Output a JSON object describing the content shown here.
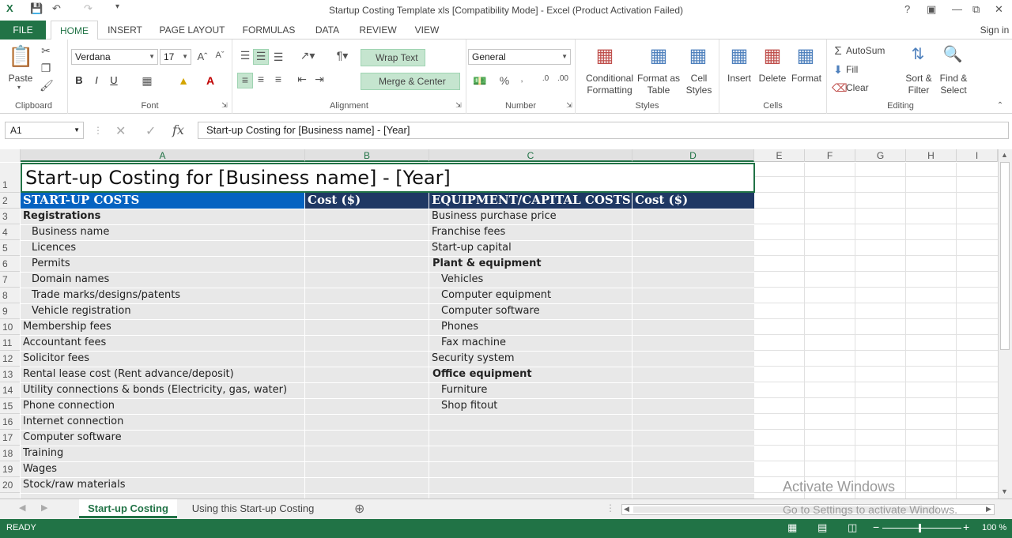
{
  "window": {
    "title": "Startup Costing Template xls  [Compatibility Mode] - Excel (Product Activation Failed)",
    "help": "?",
    "sign_in": "Sign in"
  },
  "tabs": [
    "FILE",
    "HOME",
    "INSERT",
    "PAGE LAYOUT",
    "FORMULAS",
    "DATA",
    "REVIEW",
    "VIEW"
  ],
  "ribbon": {
    "clipboard": {
      "label": "Clipboard",
      "paste": "Paste"
    },
    "font": {
      "label": "Font",
      "name": "Verdana",
      "size": "17",
      "bold": "B",
      "italic": "I",
      "underline": "U"
    },
    "alignment": {
      "label": "Alignment",
      "wrap": "Wrap Text",
      "merge": "Merge & Center"
    },
    "number": {
      "label": "Number",
      "format": "General",
      "percent": "%"
    },
    "styles": {
      "label": "Styles",
      "conditional": "Conditional",
      "conditional2": "Formatting",
      "format_table": "Format as",
      "format_table2": "Table",
      "cell_styles": "Cell",
      "cell_styles2": "Styles"
    },
    "cells": {
      "label": "Cells",
      "insert": "Insert",
      "delete": "Delete",
      "format": "Format"
    },
    "editing": {
      "label": "Editing",
      "autosum": "AutoSum",
      "fill": "Fill",
      "clear": "Clear",
      "sort": "Sort &",
      "sort2": "Filter",
      "find": "Find &",
      "find2": "Select"
    }
  },
  "formula_bar": {
    "name_box": "A1",
    "fx": "fx",
    "value": "Start-up Costing for [Business name] - [Year]"
  },
  "columns": [
    "A",
    "B",
    "C",
    "D",
    "E",
    "F",
    "G",
    "H",
    "I"
  ],
  "rows": [
    "1",
    "2",
    "3",
    "4",
    "5",
    "6",
    "7",
    "8",
    "9",
    "10",
    "11",
    "12",
    "13",
    "14",
    "15",
    "16",
    "17",
    "18",
    "19",
    "20"
  ],
  "sheet": {
    "title": "Start-up Costing for [Business name] - [Year]",
    "header": {
      "a": "START-UP COSTS",
      "b": "Cost ($)",
      "c": "EQUIPMENT/CAPITAL COSTS",
      "d": "Cost ($)"
    },
    "col_a": [
      "Registrations",
      "Business name",
      "Licences",
      "Permits",
      "Domain names",
      "Trade marks/designs/patents",
      "Vehicle registration",
      "Membership fees",
      "Accountant fees",
      "Solicitor fees",
      "Rental lease cost (Rent advance/deposit)",
      "Utility connections & bonds (Electricity, gas, water)",
      "Phone connection",
      "Internet connection",
      "Computer software",
      "Training",
      "Wages",
      "Stock/raw materials"
    ],
    "col_c": [
      "Business purchase price",
      "Franchise fees",
      "Start-up capital",
      "Plant & equipment",
      "Vehicles",
      "Computer equipment",
      "Computer software",
      "Phones",
      "Fax machine",
      "Security system",
      "Office equipment",
      "Furniture",
      "Shop fitout"
    ]
  },
  "sheet_tabs": [
    "Start-up Costing",
    "Using this Start-up Costing"
  ],
  "watermark": {
    "line1": "Activate Windows",
    "line2": "Go to Settings to activate Windows."
  },
  "status": {
    "ready": "READY",
    "zoom": "100 %"
  },
  "colors": {
    "excel_green": "#217346",
    "header_dark": "#1f3864",
    "header_blue": "#0563c1"
  }
}
